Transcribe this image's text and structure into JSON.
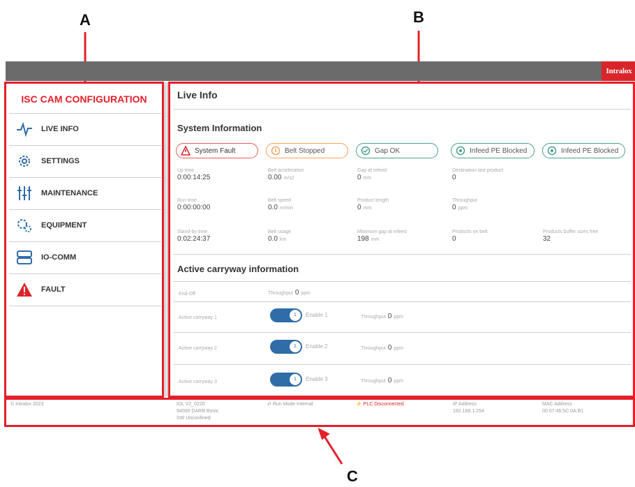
{
  "callouts": {
    "a": "A",
    "b": "B",
    "c": "C"
  },
  "header": {
    "logo": "Intralox"
  },
  "sidebar": {
    "title": "ISC CAM CONFIGURATION",
    "items": [
      {
        "label": "LIVE INFO",
        "icon": "pulse-icon"
      },
      {
        "label": "SETTINGS",
        "icon": "gear-icon"
      },
      {
        "label": "MAINTENANCE",
        "icon": "sliders-icon"
      },
      {
        "label": "EQUIPMENT",
        "icon": "gears-icon"
      },
      {
        "label": "IO-COMM",
        "icon": "server-icon"
      },
      {
        "label": "FAULT",
        "icon": "warning-icon"
      }
    ]
  },
  "main": {
    "title": "Live Info",
    "system_info": {
      "title": "System Information",
      "statuses": [
        {
          "label": "System Fault",
          "kind": "fault"
        },
        {
          "label": "Belt Stopped",
          "kind": "stopped"
        },
        {
          "label": "Gap OK",
          "kind": "ok"
        },
        {
          "label": "Infeed PE Blocked",
          "kind": "blocked"
        },
        {
          "label": "Infeed PE Blocked",
          "kind": "blocked"
        }
      ],
      "metrics": [
        {
          "label": "Up time",
          "value": "0:00:14:25",
          "unit": ""
        },
        {
          "label": "Belt acceleration",
          "value": "0.00",
          "unit": "m/s2"
        },
        {
          "label": "Gap at infeed",
          "value": "0",
          "unit": "mm"
        },
        {
          "label": "Destination last product",
          "value": "0",
          "unit": ""
        },
        {
          "label": "Run time",
          "value": "0:00:00:00",
          "unit": ""
        },
        {
          "label": "Belt speed",
          "value": "0.0",
          "unit": "m/min"
        },
        {
          "label": "Product length",
          "value": "0",
          "unit": "mm"
        },
        {
          "label": "Throughput",
          "value": "0",
          "unit": "ppm"
        },
        {
          "label": "Stand-by time",
          "value": "0:02:24:37",
          "unit": ""
        },
        {
          "label": "Belt usage",
          "value": "0.0",
          "unit": "km"
        },
        {
          "label": "Minimum gap at infeed",
          "value": "198",
          "unit": "mm"
        },
        {
          "label": "Products on belt",
          "value": "0",
          "unit": ""
        },
        {
          "label": "Products buffer sizes free",
          "value": "32",
          "unit": ""
        }
      ]
    },
    "carryway": {
      "title": "Active carryway information",
      "end_off": {
        "label": "End-Off",
        "throughput_label": "Throughput",
        "throughput_value": "0",
        "unit": "ppm"
      },
      "rows": [
        {
          "label": "Active carryway 1",
          "enable": "Enable 1",
          "knob": "1",
          "throughput_label": "Throughput",
          "throughput_value": "0",
          "unit": "ppm"
        },
        {
          "label": "Active carryway 2",
          "enable": "Enable 2",
          "knob": "1",
          "throughput_label": "Throughput",
          "throughput_value": "0",
          "unit": "ppm"
        },
        {
          "label": "Active carryway 3",
          "enable": "Enable 3",
          "knob": "1",
          "throughput_label": "Throughput",
          "throughput_value": "0",
          "unit": "ppm"
        }
      ]
    }
  },
  "footer": {
    "copyright": "© Intralox 2023",
    "version_lines": [
      "IDL V2_0220",
      "94000 DARB Bonic",
      "SW Unconfined"
    ],
    "run_mode": "Run Mode Internal",
    "plc": "PLC Disconnected",
    "ip_label": "IP Address",
    "ip_value": "192.168.1.254",
    "mac_label": "MAC Address",
    "mac_value": "00:07:46:5C:0A:B1"
  },
  "colors": {
    "accent_red": "#e3202a",
    "topbar": "#6b6b6b",
    "toggle_blue": "#2f6ca8",
    "ok_green": "#4aa08a",
    "warn_orange": "#f3a25a"
  }
}
